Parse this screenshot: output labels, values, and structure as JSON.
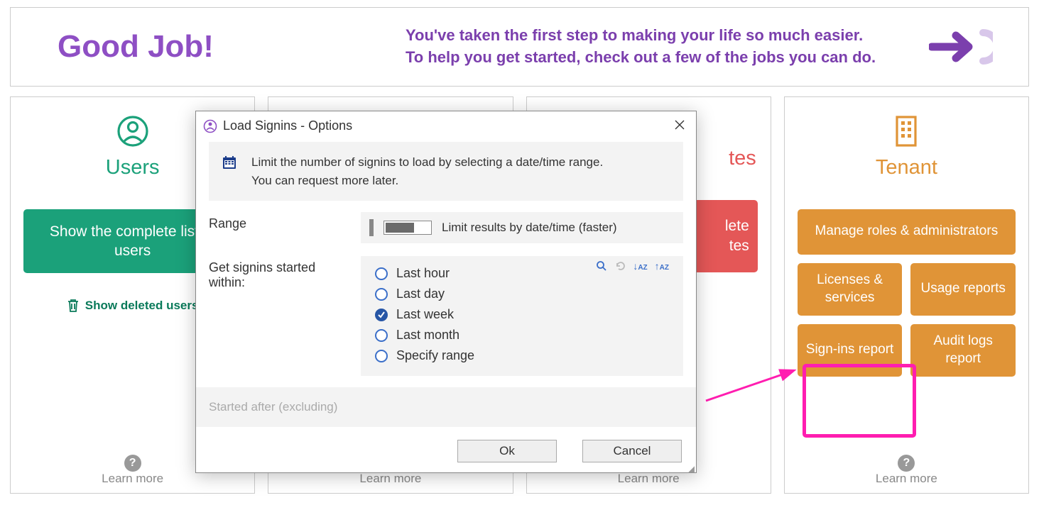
{
  "banner": {
    "heading": "Good Job!",
    "line1": "You've taken the first step to making your life so much easier.",
    "line2": "To help you get started, check out a few of the jobs you can do."
  },
  "cards": {
    "users": {
      "title": "Users",
      "btn1": "Show the complete list of users",
      "deleted": "Show deleted users"
    },
    "templates": {
      "title_suffix": "tes",
      "btn2_suffix_a": "lete",
      "btn2_suffix_b": "tes"
    },
    "tenant": {
      "title": "Tenant",
      "roles": "Manage roles & administrators",
      "licenses": "Licenses & services",
      "usage": "Usage reports",
      "signins": "Sign-ins report",
      "audit": "Audit logs report"
    },
    "learn": "Learn more"
  },
  "dialog": {
    "title": "Load Signins - Options",
    "info1": "Limit the number of signins to load by selecting a date/time range.",
    "info2": "You can request more later.",
    "range_label": "Range",
    "toggle_label": "Limit results by date/time (faster)",
    "signins_label": "Get signins started within:",
    "options": {
      "hour": "Last hour",
      "day": "Last day",
      "week": "Last week",
      "month": "Last month",
      "specify": "Specify range"
    },
    "selected": "week",
    "after_label": "Started after (excluding)",
    "ok": "Ok",
    "cancel": "Cancel"
  }
}
